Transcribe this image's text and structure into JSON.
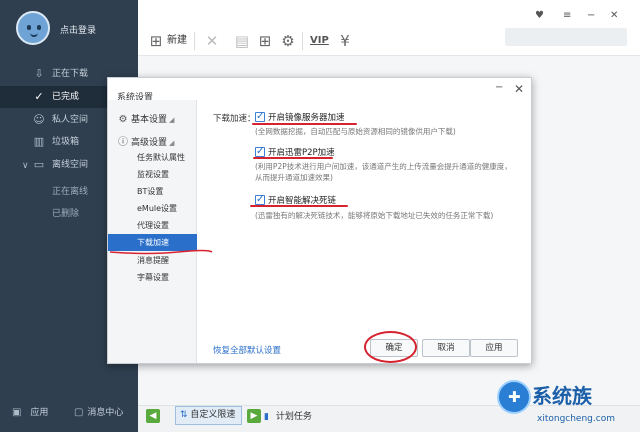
{
  "sidebar": {
    "login_label": "点击登录",
    "nav": [
      {
        "label": "正在下载",
        "icon": "download-icon"
      },
      {
        "label": "已完成",
        "icon": "check-circle-icon",
        "active": true
      },
      {
        "label": "私人空间",
        "icon": "person-icon"
      },
      {
        "label": "垃圾箱",
        "icon": "trash-icon"
      },
      {
        "label": "离线空间",
        "icon": "offline-icon"
      }
    ],
    "offline_sub": [
      "正在离线",
      "已删除"
    ],
    "bottom": {
      "apps": "应用",
      "messages": "消息中心"
    }
  },
  "toolbar": {
    "new_label": "新建",
    "vip_label": "VIP"
  },
  "statusbar": {
    "speed_mode": "自定义限速",
    "schedule": "计划任务"
  },
  "dialog": {
    "title": "系统设置",
    "categories": [
      {
        "label": "基本设置",
        "icon": "gear-icon"
      },
      {
        "label": "高级设置",
        "icon": "info-icon"
      }
    ],
    "sub_items": [
      "任务默认属性",
      "监视设置",
      "BT设置",
      "eMule设置",
      "代理设置",
      "下载加速",
      "消息提醒",
      "字幕设置"
    ],
    "selected_sub": "下载加速",
    "section_label": "下载加速：",
    "options": [
      {
        "label": "开启镜像服务器加速",
        "checked": true,
        "desc": [
          "(全网数据挖掘，自动匹配与原始资源相同的镜像供用户下载)"
        ]
      },
      {
        "label": "开启迅雷P2P加速",
        "checked": true,
        "desc": [
          "(利用P2P技术进行用户间加速，该通道产生的上传流量会提升通道的健康度，",
          "从而提升通道加速效果)"
        ]
      },
      {
        "label": "开启智能解决死链",
        "checked": true,
        "desc": [
          "(迅雷独有的解决死链技术，能够将原始下载地址已失效的任务正常下载)"
        ]
      }
    ],
    "restore_link": "恢复全部默认设置",
    "buttons": {
      "ok": "确定",
      "cancel": "取消",
      "apply": "应用"
    }
  },
  "watermark": {
    "text": "系统族",
    "url": "xitongcheng.com"
  },
  "colors": {
    "sidebar_bg": "#2f3f4f",
    "accent": "#2a6fc9",
    "annotation_red": "#d7232f"
  }
}
